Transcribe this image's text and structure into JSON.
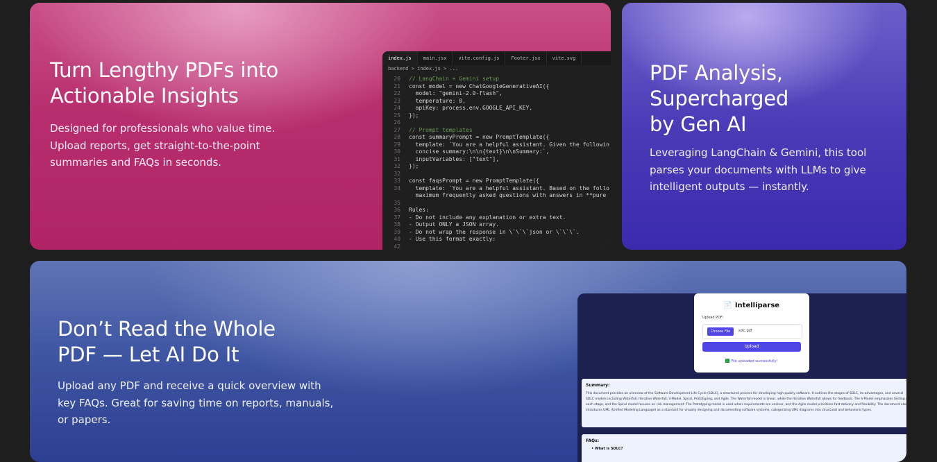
{
  "card1": {
    "title": "Turn Lengthy PDFs into Actionable Insights",
    "text": "Designed for professionals who value time. Upload reports, get straight-to-the-point summaries and FAQs in seconds.",
    "editor": {
      "tabs": [
        "index.js",
        "main.jsx",
        "vite.config.js",
        "Footer.jsx",
        "vite.svg"
      ],
      "breadcrumb": "backend > index.js > ...",
      "lines": [
        {
          "n": "20",
          "code": "// LangChain + Gemini setup",
          "comment": true
        },
        {
          "n": "21",
          "code": "const model = new ChatGoogleGenerativeAI({"
        },
        {
          "n": "22",
          "code": "  model: \"gemini-2.0-flash\","
        },
        {
          "n": "23",
          "code": "  temperature: 0,"
        },
        {
          "n": "24",
          "code": "  apiKey: process.env.GOOGLE_API_KEY,"
        },
        {
          "n": "25",
          "code": "});"
        },
        {
          "n": "26",
          "code": ""
        },
        {
          "n": "27",
          "code": "// Prompt templates",
          "comment": true
        },
        {
          "n": "28",
          "code": "const summaryPrompt = new PromptTemplate({"
        },
        {
          "n": "29",
          "code": "  template: `You are a helpful assistant. Given the followin"
        },
        {
          "n": "30",
          "code": "  concise summary:\\n\\n{text}\\n\\nSummary:`,"
        },
        {
          "n": "31",
          "code": "  inputVariables: [\"text\"],"
        },
        {
          "n": "32",
          "code": "});"
        },
        {
          "n": "32",
          "code": ""
        },
        {
          "n": "33",
          "code": "const faqsPrompt = new PromptTemplate({"
        },
        {
          "n": "34",
          "code": "  template: `You are a helpful assistant. Based on the follo"
        },
        {
          "n": "",
          "code": "  maximum frequently asked questions with answers in **pure"
        },
        {
          "n": "35",
          "code": ""
        },
        {
          "n": "36",
          "code": "Rules:"
        },
        {
          "n": "37",
          "code": "- Do not include any explanation or extra text."
        },
        {
          "n": "38",
          "code": "- Output ONLY a JSON array."
        },
        {
          "n": "39",
          "code": "- Do not wrap the response in \\`\\`\\`json or \\`\\`\\`."
        },
        {
          "n": "40",
          "code": "- Use this format exactly:"
        },
        {
          "n": "42",
          "code": ""
        }
      ]
    }
  },
  "card2": {
    "title_line1": "PDF Analysis,",
    "title_line2": "Supercharged",
    "title_line3": "by Gen AI",
    "text": "Leveraging LangChain & Gemini, this tool parses your documents with LLMs to give intelligent outputs — instantly."
  },
  "card3": {
    "title_line1": "Don’t Read the Whole",
    "title_line2": "PDF — Let AI Do It",
    "text": "Upload any PDF and receive a quick overview with key FAQs. Great for saving time on reports, manuals, or papers.",
    "app": {
      "title": "Intelliparse",
      "upload_label": "Upload PDF:",
      "choose_file": "Choose File",
      "file_name": "sdlc.pdf",
      "upload_button": "Upload",
      "status": "File uploaded successfully!",
      "summary_title": "Summary:",
      "summary_text": "This document provides an overview of the Software Development Life Cycle (SDLC), a structured process for developing high-quality software. It outlines the stages of SDLC, its advantages, and several SDLC models including Waterfall, Iterative Waterfall, V-Model, Spiral, Prototyping, and Agile. The Waterfall model is linear, while the Iterative Waterfall allows for feedback. The V-Model emphasizes testing at each stage, and the Spiral model focuses on risk management. The Prototyping model is used when requirements are unclear, and the Agile model prioritizes fast delivery and flexibility. The document also introduces UML (Unified Modeling Language) as a standard for visually designing and documenting software systems, categorizing UML diagrams into structural and behavioral types.",
      "faqs_title": "FAQs:",
      "faq_q1": "What is SDLC?"
    }
  }
}
